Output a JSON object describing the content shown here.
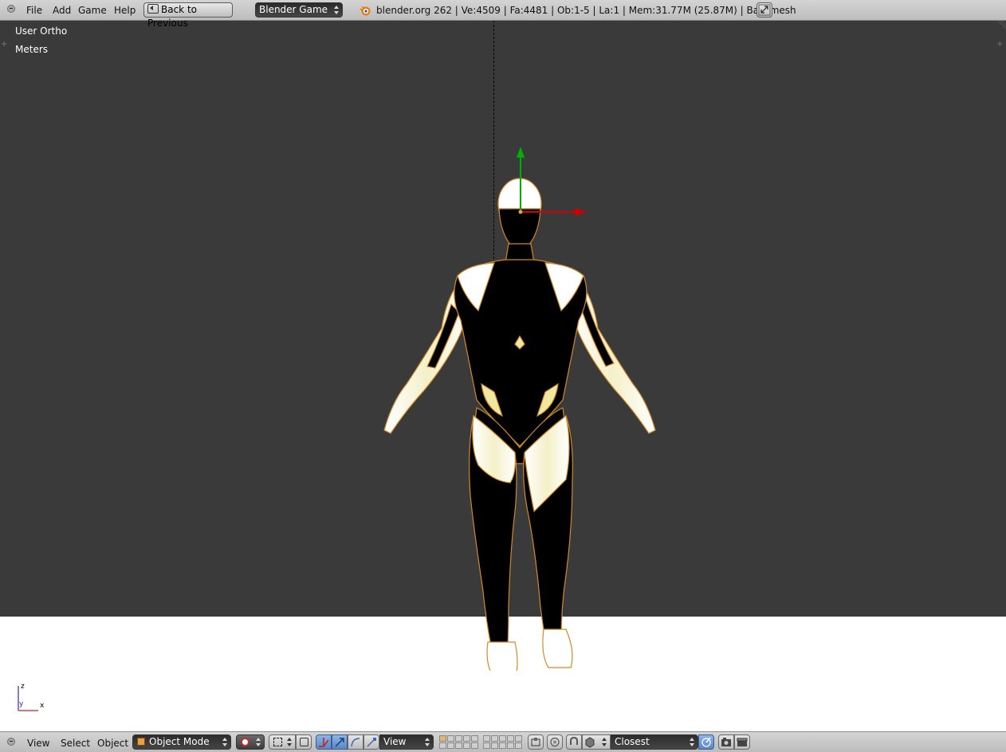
{
  "topbar": {
    "menus": [
      "File",
      "Add",
      "Game",
      "Help"
    ],
    "back_button": "Back to Previous",
    "engine": "Blender Game",
    "stats": "blender.org 262 | Ve:4509 | Fa:4481 | Ob:1-5 | La:1 | Mem:31.77M (25.87M) | Basemesh"
  },
  "viewport": {
    "view_name": "User Ortho",
    "units": "Meters",
    "axis_labels": {
      "z": "z",
      "y": "y",
      "x": "x"
    }
  },
  "bottombar": {
    "menus": [
      "View",
      "Select",
      "Object"
    ],
    "mode": "Object Mode",
    "orientation": "View",
    "snap_target": "Closest"
  },
  "icons": {
    "blender_logo": "blender-logo-icon",
    "fullscreen": "fullscreen-icon"
  },
  "colors": {
    "header": "#bdbdbd",
    "viewport_bg": "#3a3a3a",
    "ground": "#ffffff",
    "manipulator_y": "#00b000",
    "manipulator_x": "#d00000"
  }
}
